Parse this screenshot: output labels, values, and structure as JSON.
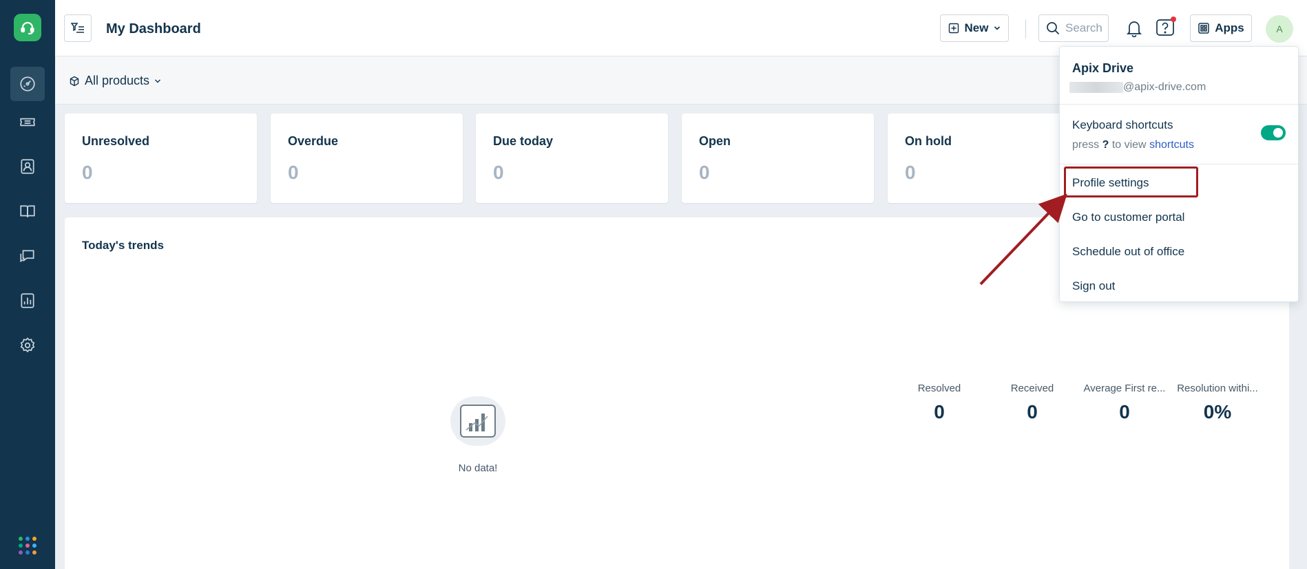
{
  "header": {
    "title": "My Dashboard",
    "new_label": "New",
    "search_placeholder": "Search",
    "apps_label": "Apps",
    "avatar_initial": "A"
  },
  "subheader": {
    "products_label": "All products"
  },
  "sidebar": {
    "items": [
      {
        "icon": "dashboard-icon",
        "active": true
      },
      {
        "icon": "ticket-icon",
        "active": false
      },
      {
        "icon": "contacts-icon",
        "active": false
      },
      {
        "icon": "knowledge-base-icon",
        "active": false
      },
      {
        "icon": "conversations-icon",
        "active": false
      },
      {
        "icon": "reports-icon",
        "active": false
      },
      {
        "icon": "admin-settings-icon",
        "active": false
      }
    ],
    "dot_colors": [
      "#2fb566",
      "#2c8be5",
      "#f5a623",
      "#00a886",
      "#e45f96",
      "#3fb2ff",
      "#9b59b6",
      "#2f7ad8",
      "#f19b3e"
    ]
  },
  "cards": [
    {
      "label": "Unresolved",
      "value": "0"
    },
    {
      "label": "Overdue",
      "value": "0"
    },
    {
      "label": "Due today",
      "value": "0"
    },
    {
      "label": "Open",
      "value": "0"
    },
    {
      "label": "On hold",
      "value": "0"
    }
  ],
  "trends": {
    "title": "Today's trends",
    "no_data": "No data!",
    "stats": [
      {
        "label": "Resolved",
        "value": "0"
      },
      {
        "label": "Received",
        "value": "0"
      },
      {
        "label": "Average First re...",
        "value": "0"
      },
      {
        "label": "Resolution withi...",
        "value": "0%"
      }
    ]
  },
  "dropdown": {
    "name": "Apix Drive",
    "email_suffix": "@apix-drive.com",
    "keyboard_shortcuts": "Keyboard shortcuts",
    "kb_hint_prefix": "press",
    "kb_hint_key": "?",
    "kb_hint_mid": "to view",
    "kb_hint_link": "shortcuts",
    "shortcuts_enabled": true,
    "items": [
      "Profile settings",
      "Go to customer portal",
      "Schedule out of office",
      "Sign out"
    ]
  },
  "colors": {
    "sidebar_bg": "#12344d",
    "accent_green": "#2fb566",
    "toggle_on": "#00a886",
    "highlight": "#a11d21"
  }
}
